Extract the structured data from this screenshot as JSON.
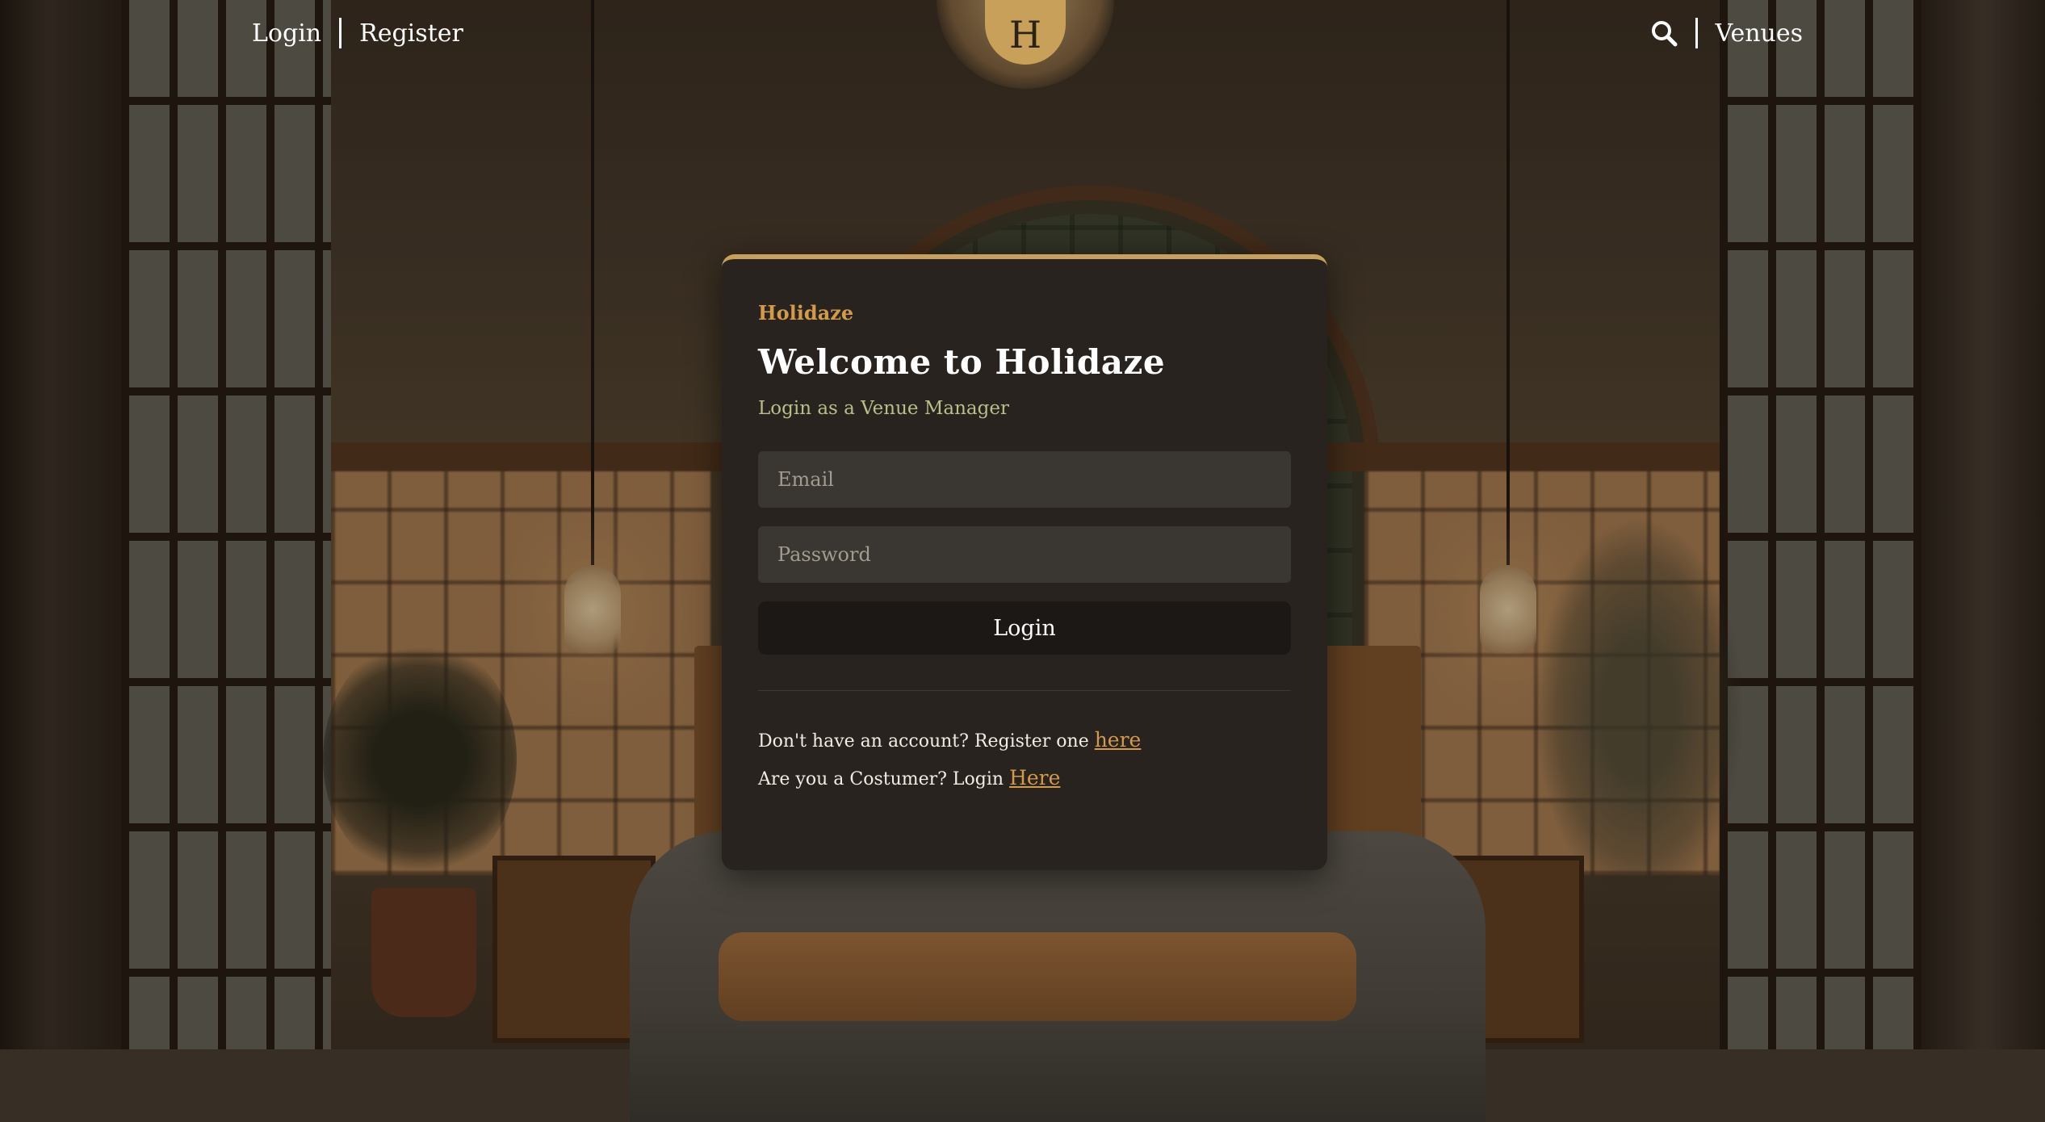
{
  "header": {
    "login_label": "Login",
    "register_label": "Register",
    "logo_letter": "H",
    "search_icon": "search-icon",
    "venues_label": "Venues"
  },
  "card": {
    "brand": "Holidaze",
    "title": "Welcome to Holidaze",
    "subtitle": "Login as a Venue Manager",
    "email_placeholder": "Email",
    "email_value": "",
    "password_placeholder": "Password",
    "password_value": "",
    "login_button": "Login",
    "register_prompt": "Don't have an account? Register one ",
    "register_link": "here",
    "customer_prompt": "Are you a Costumer? Login ",
    "customer_link": "Here"
  },
  "colors": {
    "accent": "#c9a05a",
    "link": "#d39a4a",
    "subtitle": "#b7bf8a",
    "card_bg": "#28231e",
    "input_bg": "#3a3631",
    "button_bg": "#1c1815"
  }
}
